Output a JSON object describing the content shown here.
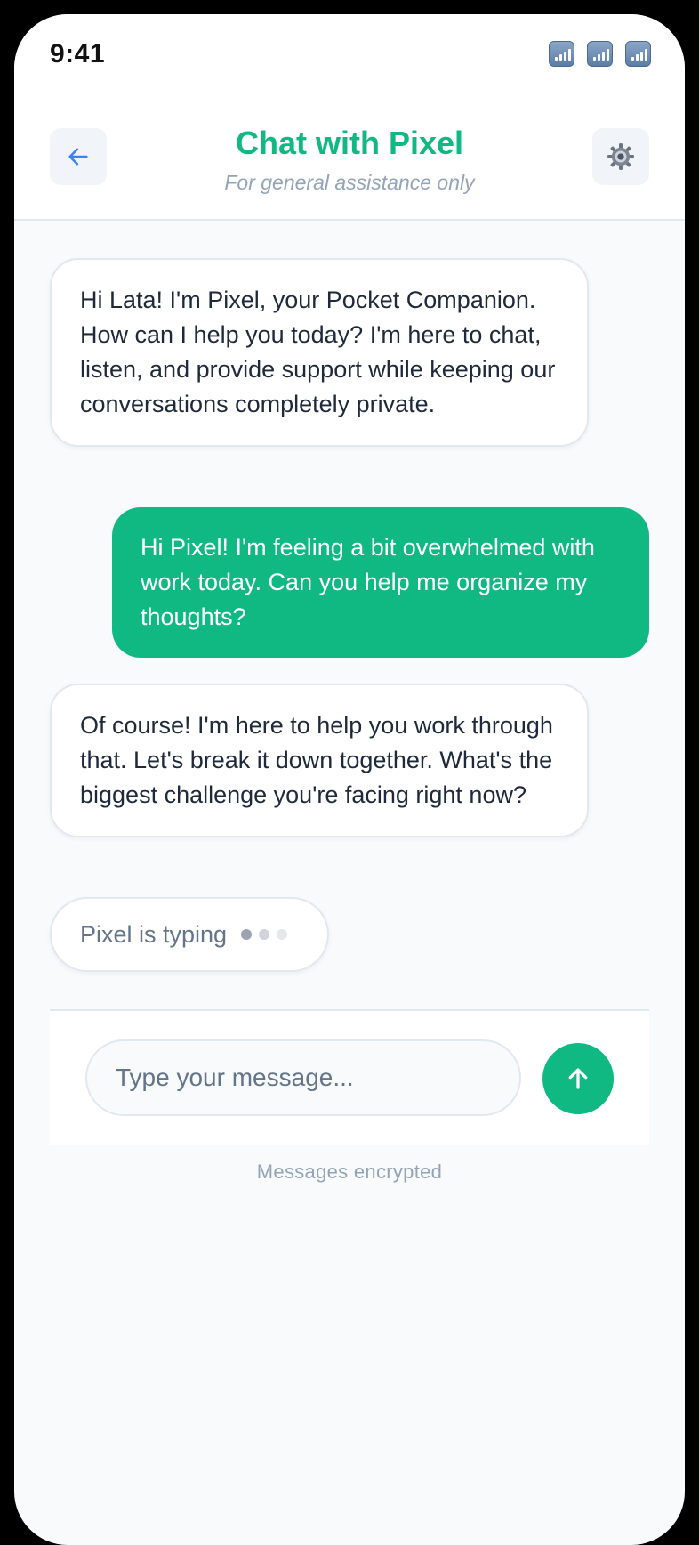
{
  "status_bar": {
    "time": "9:41",
    "icons": [
      "signal-icon",
      "signal-icon",
      "signal-icon"
    ]
  },
  "header": {
    "back_icon": "arrow-left-icon",
    "title": "Chat with Pixel",
    "subtitle": "For general assistance only",
    "settings_icon": "gear-icon"
  },
  "messages": [
    {
      "sender": "bot",
      "text": "Hi Lata! I'm Pixel, your Pocket Companion. How can I help you today? I'm here to chat, listen, and provide support while keeping our conversations completely private."
    },
    {
      "sender": "user",
      "text": "Hi Pixel! I'm feeling a bit overwhelmed with work today. Can you help me organize my thoughts?"
    },
    {
      "sender": "bot",
      "text": "Of course! I'm here to help you work through that. Let's break it down together. What's the biggest challenge you're facing right now?"
    }
  ],
  "typing_indicator": {
    "text": "Pixel is typing"
  },
  "composer": {
    "placeholder": "Type your message...",
    "value": "",
    "send_icon": "arrow-up-icon"
  },
  "footer_note": "Messages encrypted",
  "colors": {
    "accent": "#10b981",
    "background": "#f8fafc",
    "bot_bubble": "#ffffff",
    "user_text": "#ffffff",
    "muted_text": "#94a3b8"
  }
}
